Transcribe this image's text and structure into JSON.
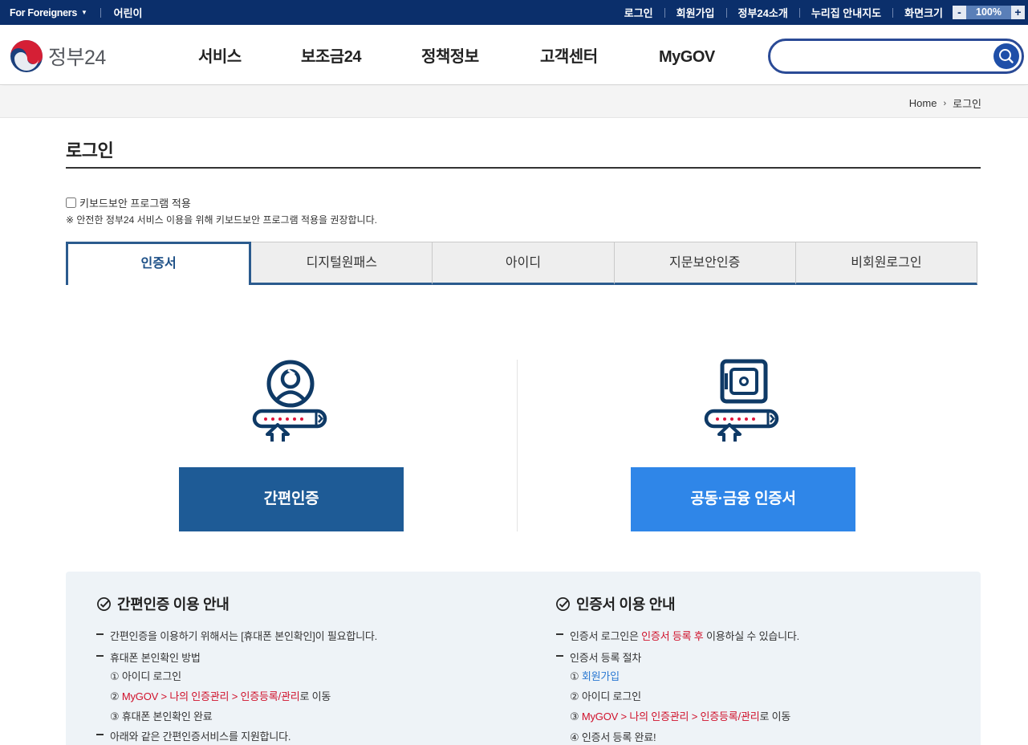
{
  "topbar": {
    "foreigners": "For Foreigners",
    "kids": "어린이",
    "links": [
      "로그인",
      "회원가입",
      "정부24소개",
      "누리집 안내지도",
      "화면크기"
    ],
    "zoom_minus": "-",
    "zoom_value": "100%",
    "zoom_plus": "+"
  },
  "header": {
    "logo_text": "정부24",
    "nav": [
      "서비스",
      "보조금24",
      "정책정보",
      "고객센터",
      "MyGOV"
    ],
    "search_placeholder": ""
  },
  "breadcrumb": {
    "home": "Home",
    "current": "로그인"
  },
  "page": {
    "title": "로그인",
    "keyboard_label": "키보드보안 프로그램 적용",
    "keyboard_note": "※ 안전한 정부24 서비스 이용을 위해 키보드보안 프로그램 적용을 권장합니다."
  },
  "tabs": [
    "인증서",
    "디지털원패스",
    "아이디",
    "지문보안인증",
    "비회원로그인"
  ],
  "methods": {
    "simple": "간편인증",
    "cert": "공동·금융 인증서"
  },
  "info": {
    "left": {
      "title": "간편인증 이용 안내",
      "l1": "간편인증을 이용하기 위해서는 [휴대폰 본인확인]이 필요합니다.",
      "l2": "휴대폰 본인확인 방법",
      "s1": "① 아이디 로그인",
      "s2_prefix": "② ",
      "s2_red": "MyGOV > 나의 인증관리 > 인증등록/관리",
      "s2_suffix": "로 이동",
      "s3": "③ 휴대폰 본인확인 완료",
      "l3": "아래와 같은 간편인증서비스를 지원합니다."
    },
    "right": {
      "title": "인증서 이용 안내",
      "l1_prefix": "인증서 로그인은 ",
      "l1_red": "인증서 등록 후",
      "l1_suffix": " 이용하실 수 있습니다.",
      "l2": "인증서 등록 절차",
      "s1_prefix": "① ",
      "s1_link": "회원가입",
      "s2": "② 아이디 로그인",
      "s3_prefix": "③ ",
      "s3_red": "MyGOV > 나의 인증관리 > 인증등록/관리",
      "s3_suffix": "로 이동",
      "s4": "④ 인증서 등록 완료!"
    }
  },
  "colors": {
    "topbar": "#0b2f6b",
    "tab_accent": "#2b5b8e",
    "simple_btn": "#1e5b96",
    "cert_btn": "#2f86e8",
    "highlight_red": "#d0112b",
    "link_blue": "#2a78d2"
  },
  "icons": {
    "simple": "person-card-login-icon",
    "cert": "safe-card-login-icon",
    "search": "magnifier-icon",
    "check": "check-circle-icon"
  }
}
